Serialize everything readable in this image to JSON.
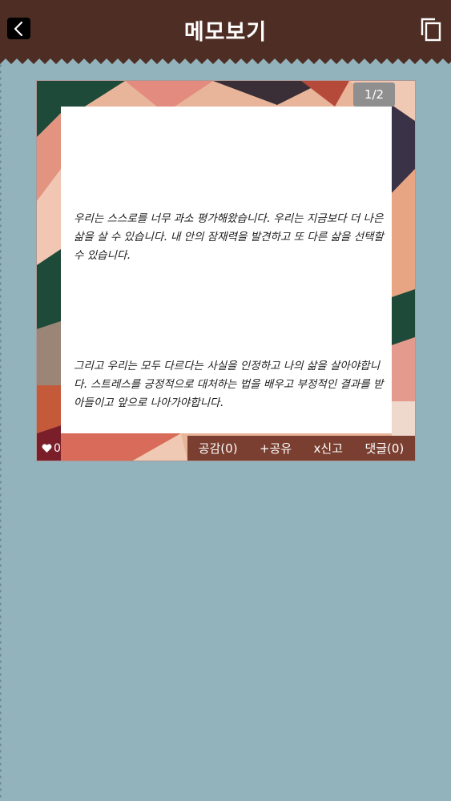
{
  "header": {
    "title": "메모보기",
    "back_icon": "chevron-left-icon",
    "copy_icon": "copy-icon"
  },
  "memo": {
    "page_indicator": "1/2",
    "paragraphs": [
      "우리는 스스로를 너무 과소 평가해왔습니다. 우리는 지금보다 더 나은 삶을 살 수 있습니다. 내 안의 잠재력을 발견하고 또 다른 삶을 선택할수 있습니다.",
      "그리고 우리는 모두 다르다는 사실을 인정하고 나의 삶을 살아야합니다. 스트레스를 긍정적으로 대처하는 법을 배우고 부정적인 결과를 받아들이고 앞으로 나아가야합니다."
    ],
    "likes_count": "0",
    "actions": {
      "empathy": "공감(0)",
      "share": "+공유",
      "report": "x신고",
      "comments": "댓글(0)"
    }
  },
  "colors": {
    "header_bg": "#4e2e24",
    "page_bg": "#93b3bc",
    "action_bar_bg": "#7a3f30"
  }
}
